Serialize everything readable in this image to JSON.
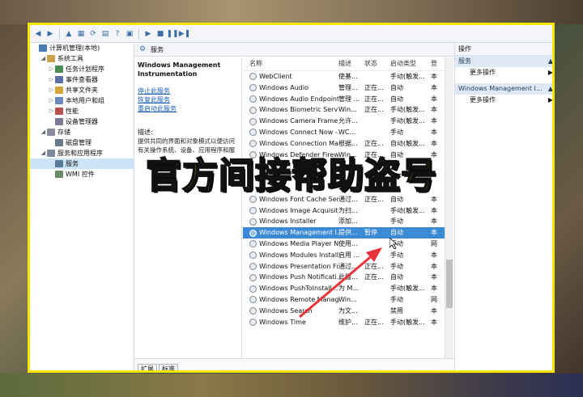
{
  "tree": {
    "items": [
      {
        "label": "计算机管理(本地)",
        "level": 0,
        "exp": "",
        "icon": "#4a7ab5"
      },
      {
        "label": "系统工具",
        "level": 1,
        "exp": "◢",
        "icon": "#c9a24a"
      },
      {
        "label": "任务计划程序",
        "level": 2,
        "exp": "▷",
        "icon": "#4a8a55"
      },
      {
        "label": "事件查看器",
        "level": 2,
        "exp": "▷",
        "icon": "#5a6fa5"
      },
      {
        "label": "共享文件夹",
        "level": 2,
        "exp": "▷",
        "icon": "#d4a43a"
      },
      {
        "label": "本地用户和组",
        "level": 2,
        "exp": "▷",
        "icon": "#6a8abf"
      },
      {
        "label": "性能",
        "level": 2,
        "exp": "▷",
        "icon": "#b85050"
      },
      {
        "label": "设备管理器",
        "level": 2,
        "exp": "",
        "icon": "#7a7a95"
      },
      {
        "label": "存储",
        "level": 1,
        "exp": "◢",
        "icon": "#8a8aa0"
      },
      {
        "label": "磁盘管理",
        "level": 2,
        "exp": "",
        "icon": "#6a7a8a"
      },
      {
        "label": "服务和应用程序",
        "level": 1,
        "exp": "◢",
        "icon": "#7a8aa0"
      },
      {
        "label": "服务",
        "level": 2,
        "exp": "",
        "icon": "#5a7a9a",
        "selected": true
      },
      {
        "label": "WMI 控件",
        "level": 2,
        "exp": "",
        "icon": "#6a8a6a"
      }
    ]
  },
  "header": {
    "title": "服务"
  },
  "description": {
    "service_name": "Windows Management Instrumentation",
    "links": [
      "停止此服务",
      "恢复此服务",
      "重启动此服务"
    ],
    "desc_label": "描述:",
    "desc_lines": [
      "提供共同的界面和对象模式以便访问",
      "有关操作系统、设备、应用程序和服"
    ]
  },
  "grid": {
    "headers": {
      "name": "名称",
      "desc": "描述",
      "status": "状态",
      "startup": "启动类型",
      "logon": "登"
    },
    "rows": [
      {
        "name": "WebClient",
        "desc": "使基...",
        "status": "",
        "startup": "手动(触发...",
        "logon": "本"
      },
      {
        "name": "Windows Audio",
        "desc": "管理...",
        "status": "正在...",
        "startup": "自动",
        "logon": "本"
      },
      {
        "name": "Windows Audio Endpoint...",
        "desc": "管理 ...",
        "status": "正在...",
        "startup": "自动",
        "logon": "本"
      },
      {
        "name": "Windows Biometric Servi...",
        "desc": "Win...",
        "status": "正在...",
        "startup": "手动(触发...",
        "logon": "本"
      },
      {
        "name": "Windows Camera Frame ...",
        "desc": "允许...",
        "status": "",
        "startup": "手动(触发...",
        "logon": "本"
      },
      {
        "name": "Windows Connect Now -...",
        "desc": "WC...",
        "status": "",
        "startup": "手动",
        "logon": "本"
      },
      {
        "name": "Windows Connection Ma...",
        "desc": "根据...",
        "status": "正在...",
        "startup": "自动(触发...",
        "logon": "本"
      },
      {
        "name": "Windows Defender Firew...",
        "desc": "Win...",
        "status": "正在...",
        "startup": "自动",
        "logon": "本"
      },
      {
        "name": "",
        "desc": "",
        "status": "",
        "startup": "",
        "logon": ""
      },
      {
        "name": "",
        "desc": "",
        "status": "",
        "startup": "",
        "logon": ""
      },
      {
        "name": "",
        "desc": "",
        "status": "",
        "startup": "",
        "logon": ""
      },
      {
        "name": "Windows Font Cache Ser...",
        "desc": "通过...",
        "status": "正在...",
        "startup": "自动",
        "logon": "本"
      },
      {
        "name": "Windows Image Acquisiti...",
        "desc": "为扫...",
        "status": "",
        "startup": "手动(触发...",
        "logon": "本"
      },
      {
        "name": "Windows Installer",
        "desc": "添加...",
        "status": "",
        "startup": "手动",
        "logon": "本"
      },
      {
        "name": "Windows Management I...",
        "desc": "提供...",
        "status": "暂停",
        "startup": "自动",
        "logon": "本",
        "selected": true
      },
      {
        "name": "Windows Media Player N...",
        "desc": "使用...",
        "status": "",
        "startup": "手动",
        "logon": "网"
      },
      {
        "name": "Windows Modules Install...",
        "desc": "启用 ...",
        "status": "",
        "startup": "手动",
        "logon": "本"
      },
      {
        "name": "Windows Presentation Fo...",
        "desc": "通过...",
        "status": "正在...",
        "startup": "手动",
        "logon": "本"
      },
      {
        "name": "Windows Push Notificati...",
        "desc": "此服...",
        "status": "正在...",
        "startup": "自动",
        "logon": "本"
      },
      {
        "name": "Windows PushToInstall...",
        "desc": "为 M...",
        "status": "",
        "startup": "手动(触发...",
        "logon": "本"
      },
      {
        "name": "Windows Remote Manag...",
        "desc": "Win...",
        "status": "",
        "startup": "手动",
        "logon": "网"
      },
      {
        "name": "Windows Search",
        "desc": "为文...",
        "status": "",
        "startup": "禁用",
        "logon": "本"
      },
      {
        "name": "Windows Time",
        "desc": "维护...",
        "status": "正在...",
        "startup": "手动(触发...",
        "logon": "本"
      }
    ]
  },
  "tabs": [
    "扩展",
    "标准"
  ],
  "actions": {
    "title": "操作",
    "sections": [
      {
        "title": "服务",
        "item": "更多操作"
      },
      {
        "title": "Windows Management I...",
        "item": "更多操作"
      }
    ]
  },
  "overlay_text": "官方间接帮助盗号",
  "colors": {
    "frame": "#f5e600",
    "selection": "#3b8ad6",
    "arrow": "#e8333a"
  }
}
